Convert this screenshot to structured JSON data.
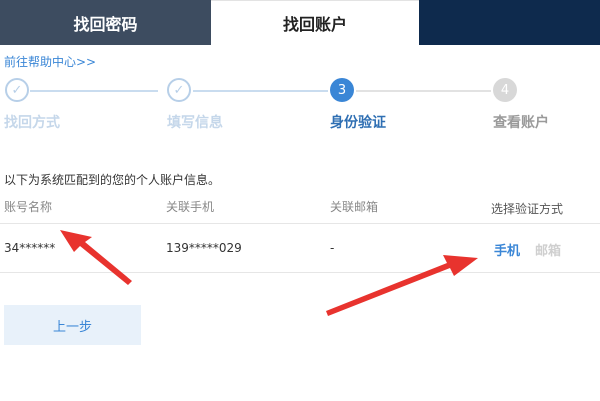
{
  "tabs": [
    {
      "label": "找回密码",
      "active": false
    },
    {
      "label": "找回账户",
      "active": true
    }
  ],
  "help_link": "前往帮助中心>>",
  "steps": [
    {
      "number": "✓",
      "label": "找回方式",
      "state": "done"
    },
    {
      "number": "✓",
      "label": "填写信息",
      "state": "done"
    },
    {
      "number": "3",
      "label": "身份验证",
      "state": "current"
    },
    {
      "number": "4",
      "label": "查看账户",
      "state": "todo"
    }
  ],
  "intro_text": "以下为系统匹配到的您的个人账户信息。",
  "table": {
    "headers": [
      "账号名称",
      "关联手机",
      "关联邮箱",
      "选择验证方式"
    ],
    "row": {
      "account": "34******",
      "phone": "139*****029",
      "email": "-",
      "verify_options": [
        "手机",
        "邮箱"
      ]
    }
  },
  "prev_button": "上一步",
  "colors": {
    "accent": "#3a86d6",
    "tab_dark": "#3d4c60",
    "tab_navy": "#0e2a4d",
    "annotation_arrow": "#e8332e"
  }
}
